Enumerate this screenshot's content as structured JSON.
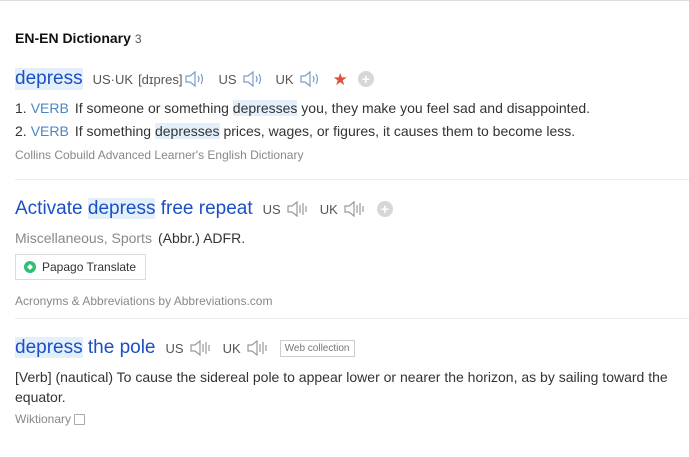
{
  "section": {
    "title": "EN-EN Dictionary",
    "count": "3"
  },
  "entry1": {
    "word": "depress",
    "pron_us_uk_label": "US·UK",
    "phonetic": "[dɪpres]",
    "pron_us_label": "US",
    "pron_uk_label": "UK",
    "defs": [
      {
        "num": "1.",
        "pos": "VERB",
        "pre": "If someone or something ",
        "hl": "depresses",
        "post": " you, they make you feel sad and disappointed."
      },
      {
        "num": "2.",
        "pos": "VERB",
        "pre": "If something ",
        "hl": "depresses",
        "post": " prices, wages, or figures, it causes them to become less."
      }
    ],
    "source": "Collins Cobuild Advanced Learner's English Dictionary"
  },
  "entry2": {
    "word_pre": "Activate ",
    "word_hl": "depress",
    "word_post": " free repeat",
    "pron_us_label": "US",
    "pron_uk_label": "UK",
    "category": "Miscellaneous, Sports",
    "abbr": "(Abbr.) ADFR.",
    "papago_label": "Papago Translate",
    "source": "Acronyms & Abbreviations by Abbreviations.com"
  },
  "entry3": {
    "word_hl": "depress",
    "word_post": " the pole",
    "pron_us_label": "US",
    "pron_uk_label": "UK",
    "web_tag": "Web collection",
    "definition": "[Verb] (nautical) To cause the sidereal pole to appear lower or nearer the horizon, as by sailing toward the equator.",
    "source": "Wiktionary"
  },
  "colors": {
    "link": "#1a4fc7",
    "pos": "#4a86c5",
    "star": "#e0503a",
    "highlight": "#e3effb",
    "papago": "#2fbf71"
  },
  "icons": [
    "speaker-icon",
    "star-icon",
    "plus-icon",
    "papago-logo-icon",
    "copy-icon"
  ]
}
